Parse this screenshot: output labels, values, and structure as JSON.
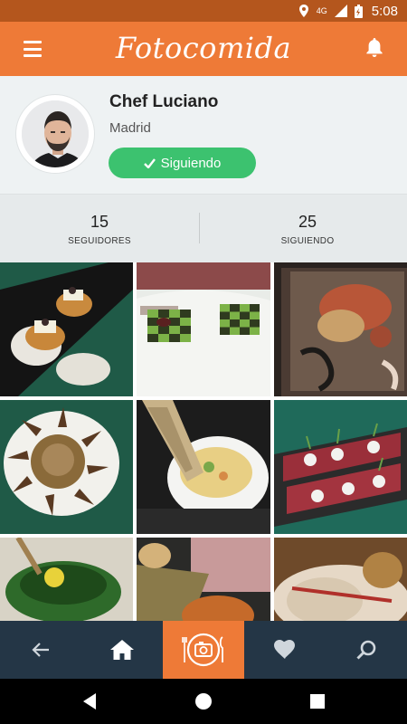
{
  "status_bar": {
    "network": "4G",
    "time": "5:08"
  },
  "app_bar": {
    "title": "Fotocomida"
  },
  "profile": {
    "name": "Chef Luciano",
    "city": "Madrid",
    "follow_button": "Siguiendo"
  },
  "stats": [
    {
      "value": "15",
      "label": "SEGUIDORES"
    },
    {
      "value": "25",
      "label": "SIGUIENDO"
    }
  ],
  "photos": [
    {
      "name": "photo-dumplings-on-salt"
    },
    {
      "name": "photo-checkered-cucumber"
    },
    {
      "name": "photo-crab-dish"
    },
    {
      "name": "photo-fried-artichoke"
    },
    {
      "name": "photo-corn-soup"
    },
    {
      "name": "photo-tuna-tartare"
    },
    {
      "name": "photo-green-bowl"
    },
    {
      "name": "photo-tart"
    },
    {
      "name": "photo-bread-plate"
    }
  ],
  "bottom_nav": [
    "back-icon",
    "home-icon",
    "camera-plate-icon",
    "heart-icon",
    "search-icon"
  ],
  "colors": {
    "primary": "#ee7a37",
    "status_bar": "#b4561d",
    "follow": "#3cc26f",
    "nav": "#243646"
  }
}
